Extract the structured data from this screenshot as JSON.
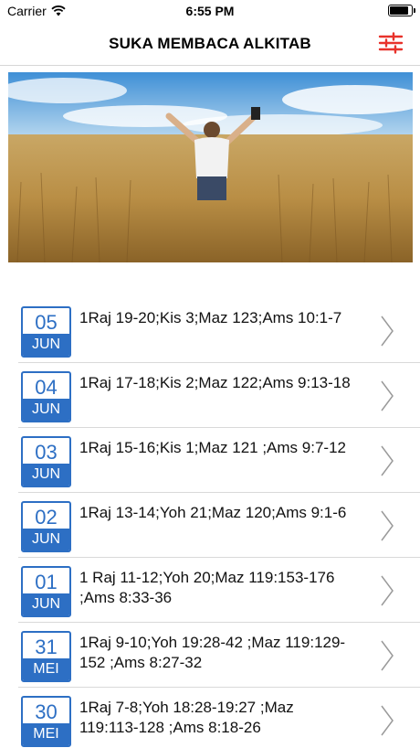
{
  "status_bar": {
    "carrier": "Carrier",
    "time": "6:55 PM",
    "battery_level": 0.9
  },
  "nav": {
    "title": "SUKA MEMBACA ALKITAB",
    "filter_icon": "sliders-icon",
    "accent_color": "#e8322b"
  },
  "hero": {
    "image": "man-arms-raised-holding-bible-in-wheat-field"
  },
  "theme": {
    "badge_color": "#2d6fc4"
  },
  "readings": [
    {
      "day": "05",
      "month": "JUN",
      "text": "1Raj 19-20;Kis 3;Maz 123;Ams 10:1-7"
    },
    {
      "day": "04",
      "month": "JUN",
      "text": "1Raj 17-18;Kis 2;Maz 122;Ams 9:13-18"
    },
    {
      "day": "03",
      "month": "JUN",
      "text": "1Raj 15-16;Kis 1;Maz 121 ;Ams 9:7-12"
    },
    {
      "day": "02",
      "month": "JUN",
      "text": "1Raj 13-14;Yoh 21;Maz 120;Ams 9:1-6"
    },
    {
      "day": "01",
      "month": "JUN",
      "text": "1 Raj 11-12;Yoh 20;Maz 119:153-176 ;Ams 8:33-36"
    },
    {
      "day": "31",
      "month": "MEI",
      "text": "1Raj 9-10;Yoh 19:28-42 ;Maz 119:129-152 ;Ams 8:27-32"
    },
    {
      "day": "30",
      "month": "MEI",
      "text": "1Raj 7-8;Yoh 18:28-19:27 ;Maz 119:113-128 ;Ams 8:18-26"
    }
  ]
}
